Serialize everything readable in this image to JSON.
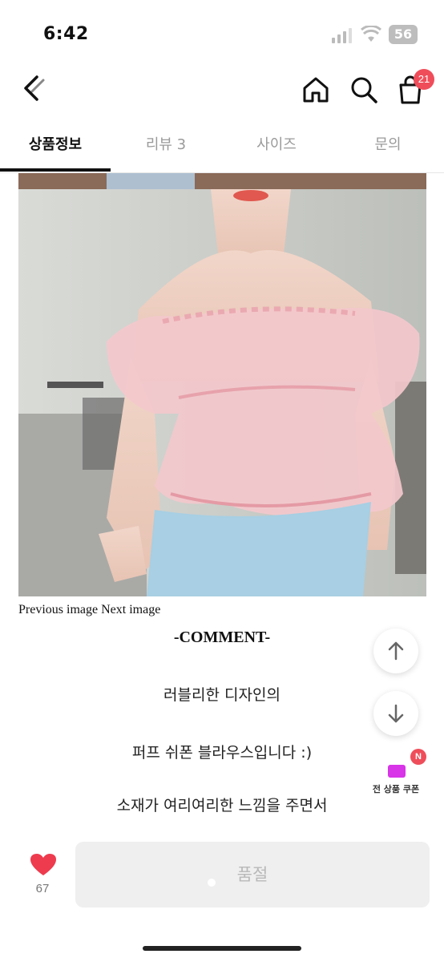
{
  "status_bar": {
    "time": "6:42",
    "battery": "56"
  },
  "nav": {
    "cart_count": "21"
  },
  "tabs": [
    {
      "label": "상품정보"
    },
    {
      "label": "리뷰 3"
    },
    {
      "label": "사이즈"
    },
    {
      "label": "문의"
    }
  ],
  "content": {
    "image_nav": "Previous image Next image",
    "comment_title": "-COMMENT-",
    "lines": [
      "러블리한 디자인의",
      "퍼프 쉬폰 블라우스입니다 :)",
      "소재가 여리여리한 느낌을 주면서"
    ]
  },
  "coupon": {
    "label": "전 상품 쿠폰",
    "badge": "N"
  },
  "bottom_bar": {
    "like_count": "67",
    "soldout_label": "품절"
  },
  "colors": {
    "accent": "#ef4d5a",
    "coupon_icon": "#d834e8",
    "heart": "#ee3b4e"
  },
  "icons": [
    "back-icon",
    "home-icon",
    "search-icon",
    "bag-icon",
    "arrow-up-icon",
    "arrow-down-icon",
    "coupon-icon",
    "heart-icon"
  ]
}
